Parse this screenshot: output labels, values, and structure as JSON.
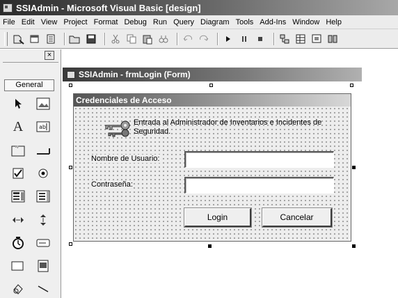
{
  "window": {
    "title": "SSIAdmin - Microsoft Visual Basic [design]"
  },
  "menu": [
    "File",
    "Edit",
    "View",
    "Project",
    "Format",
    "Debug",
    "Run",
    "Query",
    "Diagram",
    "Tools",
    "Add-Ins",
    "Window",
    "Help"
  ],
  "toolbar": {
    "icons": [
      "add-project-icon",
      "add-form-icon",
      "menu-editor-icon",
      "open-project-icon",
      "save-project-icon",
      "cut-icon",
      "copy-icon",
      "paste-icon",
      "find-icon",
      "undo-icon",
      "redo-icon",
      "start-icon",
      "break-icon",
      "end-icon",
      "project-explorer-icon",
      "properties-window-icon",
      "form-layout-icon",
      "object-browser-icon"
    ]
  },
  "toolbox": {
    "close_glyph": "×",
    "tab_label": "General",
    "tools": [
      "Pointer",
      "PictureBox",
      "Label",
      "TextBox",
      "Frame",
      "CommandButton",
      "CheckBox",
      "OptionButton",
      "ComboBox",
      "ListBox",
      "HScrollBar",
      "VScrollBar",
      "Timer",
      "DriveListBox",
      "Shape",
      "Image",
      "OLE",
      "Line"
    ]
  },
  "child": {
    "title": "SSIAdmin - frmLogin (Form)"
  },
  "form": {
    "caption": "Credenciales de Acceso",
    "message": "Entrada al Administrador de Inventarios e Incidentes de Seguridad.",
    "username_label": "Nombre de Usuario:",
    "username_value": "",
    "password_label": "Contraseña:",
    "password_value": "",
    "login_button": "Login",
    "cancel_button": "Cancelar"
  }
}
